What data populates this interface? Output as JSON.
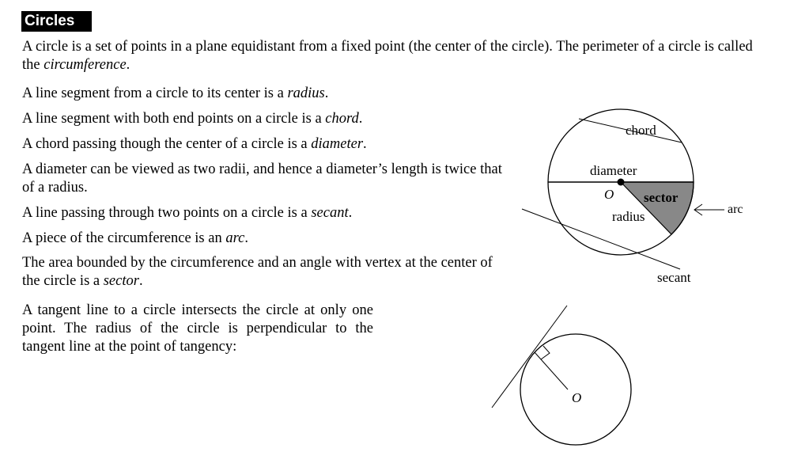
{
  "section_title": "Circles",
  "paragraphs": {
    "p1_a": "A circle is a set of points in a plane equidistant from a fixed point (the center of the circle).  The perimeter of a circle is called the ",
    "p1_em": "circumference",
    "p1_b": ".",
    "p2_a": "A line segment from a circle to its center is a ",
    "p2_em": "radius",
    "p2_b": ".",
    "p3_a": "A line segment with both end points on a circle is a ",
    "p3_em": "chord",
    "p3_b": ".",
    "p4_a": "A chord passing though the center of a circle is a ",
    "p4_em": "diameter",
    "p4_b": ".",
    "p5": "A diameter can be viewed as two radii, and hence a diameter’s length is twice that of a radius.",
    "p6_a": "A line passing through two points on a circle is a ",
    "p6_em": "secant",
    "p6_b": ".",
    "p7_a": "A piece of the circumference is an ",
    "p7_em": "arc",
    "p7_b": ".",
    "p8_a": "The area bounded by the circumference and an angle with vertex at the center of the circle is a ",
    "p8_em": "sector",
    "p8_b": ".",
    "p9": "A tangent line to a circle intersects the circle at only one point.  The radius of the circle is perpendicular to the tangent line at the point of tangency:"
  },
  "figure1": {
    "chord": "chord",
    "diameter": "diameter",
    "center": "O",
    "sector": "sector",
    "radius": "radius",
    "arc": "arc",
    "secant": "secant"
  },
  "figure2": {
    "center": "O"
  }
}
